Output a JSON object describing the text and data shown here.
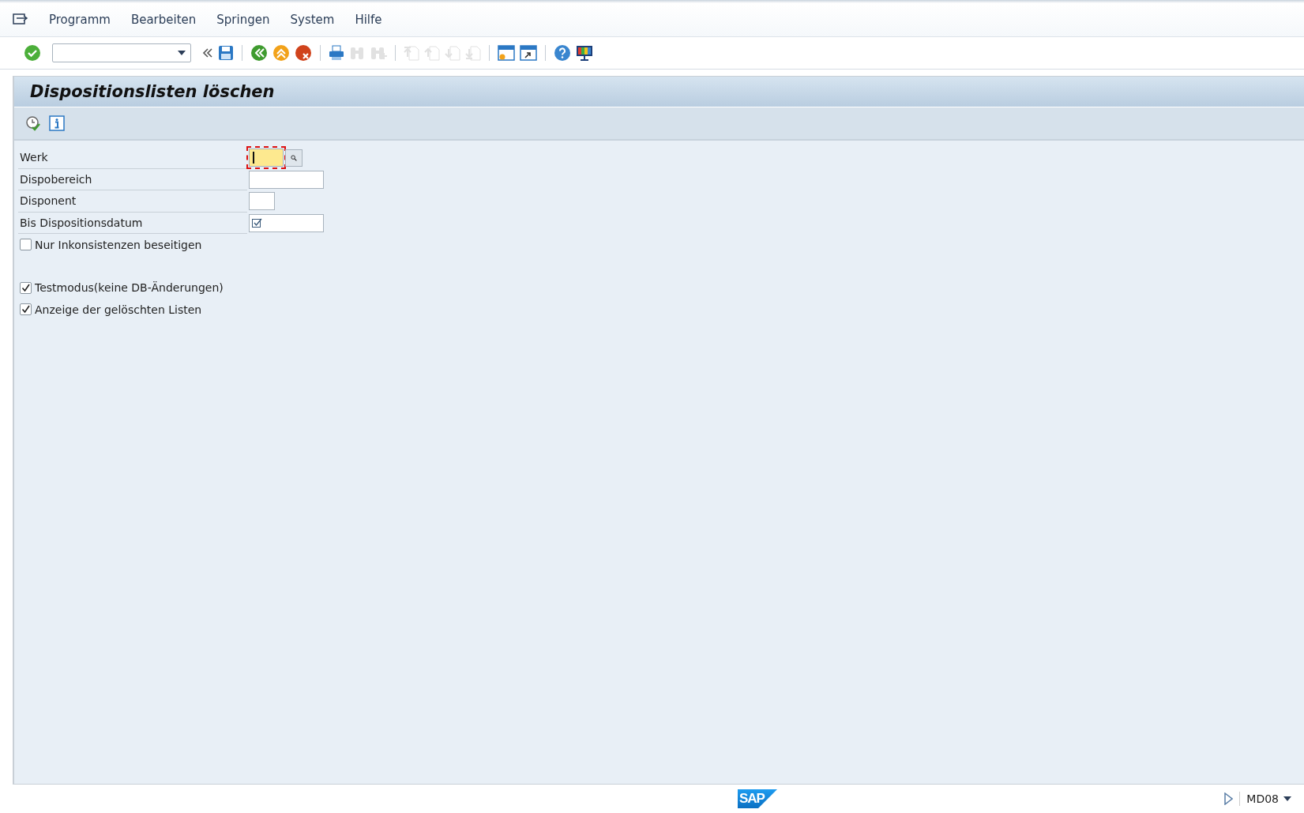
{
  "menu_bar": {
    "items": [
      {
        "label": "Programm"
      },
      {
        "label": "Bearbeiten"
      },
      {
        "label": "Springen"
      },
      {
        "label": "System"
      },
      {
        "label": "Hilfe"
      }
    ]
  },
  "toolbar": {
    "items": [
      {
        "kind": "enter",
        "disabled": false
      },
      {
        "kind": "command"
      },
      {
        "kind": "collapse",
        "disabled": false
      },
      {
        "kind": "save",
        "disabled": false
      },
      {
        "kind": "sep"
      },
      {
        "kind": "back",
        "disabled": false
      },
      {
        "kind": "exit",
        "disabled": false
      },
      {
        "kind": "cancel",
        "disabled": false
      },
      {
        "kind": "sep"
      },
      {
        "kind": "print",
        "disabled": false
      },
      {
        "kind": "find",
        "disabled": true
      },
      {
        "kind": "findnext",
        "disabled": true
      },
      {
        "kind": "sep"
      },
      {
        "kind": "first",
        "disabled": true
      },
      {
        "kind": "prev",
        "disabled": true
      },
      {
        "kind": "next",
        "disabled": true
      },
      {
        "kind": "last",
        "disabled": true
      },
      {
        "kind": "sep"
      },
      {
        "kind": "session",
        "disabled": false
      },
      {
        "kind": "shortcut",
        "disabled": false
      },
      {
        "kind": "sep"
      },
      {
        "kind": "help",
        "disabled": false
      },
      {
        "kind": "layout",
        "disabled": false
      }
    ]
  },
  "screen": {
    "title": "Dispositionslisten löschen",
    "app_toolbar": [
      {
        "kind": "execute"
      },
      {
        "kind": "info"
      }
    ],
    "fields": [
      {
        "label": "Werk",
        "focused": true,
        "search_help": true,
        "required": false
      },
      {
        "label": "Dispobereich",
        "focused": false,
        "search_help": false,
        "required": false
      },
      {
        "label": "Disponent",
        "focused": false,
        "search_help": false,
        "required": false
      },
      {
        "label": "Bis Dispositionsdatum",
        "focused": false,
        "search_help": false,
        "required": true
      }
    ],
    "options": [
      {
        "label": "Nur Inkonsistenzen beseitigen",
        "checked": false
      },
      {
        "label": "Testmodus(keine DB-Änderungen)",
        "checked": true
      },
      {
        "label": "Anzeige der gelöschten Listen",
        "checked": true
      }
    ]
  },
  "status_bar": {
    "logo": "SAP",
    "transaction": "MD08"
  }
}
